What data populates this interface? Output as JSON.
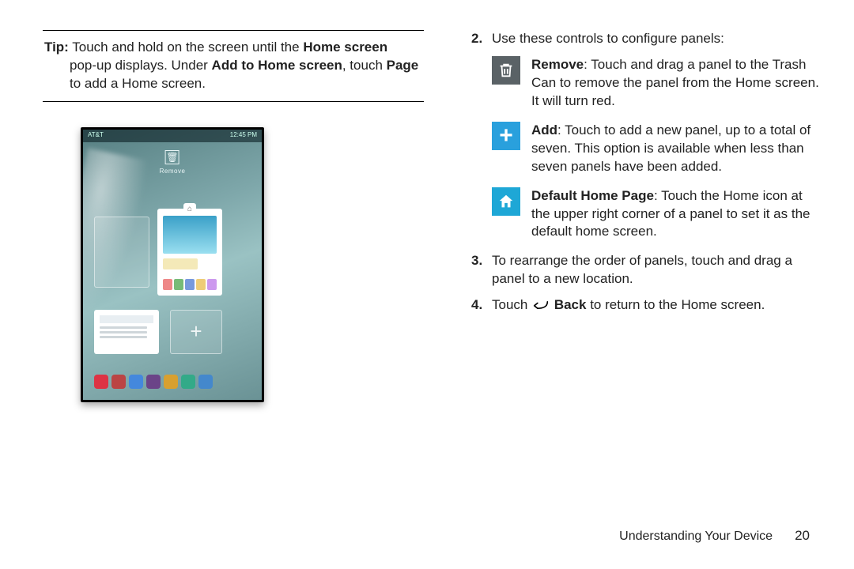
{
  "left": {
    "tip_label": "Tip:",
    "tip_line1_a": " Touch and hold on the screen until the ",
    "tip_line1_b": "Home screen",
    "tip_line2_a": "pop-up displays. Under ",
    "tip_line2_b": "Add to Home screen",
    "tip_line2_c": ", touch ",
    "tip_line2_d": "Page",
    "tip_line3": "to add a Home screen."
  },
  "screenshot": {
    "carrier": "AT&T",
    "time": "12:45 PM",
    "remove_label": "Remove"
  },
  "right": {
    "step2_num": "2.",
    "step2_text": "Use these controls to configure panels:",
    "remove_label": "Remove",
    "remove_text": ": Touch and drag a panel to the Trash Can to remove the panel from the Home screen. It will turn red.",
    "add_label": "Add",
    "add_text": ": Touch to add a new panel, up to a total of seven. This option is available when less than seven panels have been added.",
    "home_label": "Default Home Page",
    "home_text": ": Touch the Home icon at the upper right corner of a panel to set it as the default home screen.",
    "step3_num": "3.",
    "step3_text": "To rearrange the order of panels, touch and drag a panel to a new location.",
    "step4_num": "4.",
    "step4_a": "Touch ",
    "step4_back": "Back",
    "step4_b": " to return to the Home screen."
  },
  "footer": {
    "section": "Understanding Your Device",
    "page": "20"
  }
}
